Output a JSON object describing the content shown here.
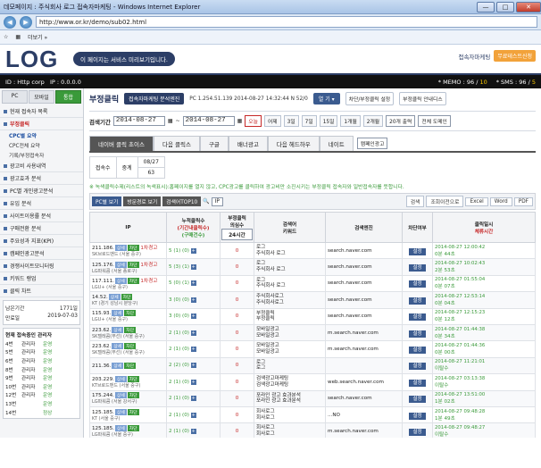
{
  "window": {
    "title": "데모페이지 : 주식회사 로그 접속자마케팅 - Windows Internet Explorer",
    "min": "—",
    "max": "□",
    "close": "✕"
  },
  "browser": {
    "url": "http://www.or.kr/demo/sub02.html",
    "tools": "더보기 »"
  },
  "header": {
    "logo": "LOG",
    "notice": "이 페이지는 서비스 미리보기입니다.",
    "brand": "접속자마케팅",
    "trial": "무료테스트신청"
  },
  "status": {
    "id": "ID : Http corp",
    "ip": "IP : 0.0.0.0",
    "memo_label": "* MEMO :",
    "memo": "96",
    "memo_total": "10",
    "sms_label": "* SMS :",
    "sms": "96",
    "sms_total": "5"
  },
  "sidebar": {
    "tabs": [
      "PC",
      "모바일",
      "통합"
    ],
    "menu": [
      {
        "label": "현재 접속자 목록",
        "on": false
      },
      {
        "label": "부정클릭",
        "on": true
      }
    ],
    "sub": [
      "CPC별 요약",
      "CPC전체 요약",
      "기록/부정접속자"
    ],
    "menu2": [
      "광고비 사용내역",
      "광고효과 분석",
      "PC별 개인광고분석",
      "유입 분석",
      "사이트이용률 분석",
      "구매전환 분석",
      "주요성과 지표(KPI)",
      "캠페인광고분석",
      "경쟁사이트모니터링",
      "키워드 랭업",
      "클릭 차트"
    ],
    "box": [
      {
        "k": "남은기간",
        "v": "1771일"
      },
      {
        "k": "만료일",
        "v": "2019-07-03"
      }
    ],
    "online_title": "현재 접속중인 관리자",
    "online": [
      {
        "n": "4번",
        "r": "관리자",
        "s": "운영"
      },
      {
        "n": "5번",
        "r": "관리자",
        "s": "운영"
      },
      {
        "n": "6번",
        "r": "관리자",
        "s": "운영"
      },
      {
        "n": "8번",
        "r": "관리자",
        "s": "운영"
      },
      {
        "n": "9번",
        "r": "관리자",
        "s": "운영"
      },
      {
        "n": "10번",
        "r": "관리자",
        "s": "운영"
      },
      {
        "n": "12번",
        "r": "관리자",
        "s": "운영"
      },
      {
        "n": "13번",
        "r": "",
        "s": "운영"
      },
      {
        "n": "14번",
        "r": "",
        "s": "정상"
      }
    ]
  },
  "page": {
    "title": "부정클릭",
    "engine": "접속자마케팅 분석엔진",
    "pcinfo": "PC 1.254.51.139 2014-08-27 14:32:44 N 52/0",
    "dropdown": "열 기 ▾",
    "btn_setting": "차단/부정클릭 설정",
    "btn_guide": "부정클릭 안내디스",
    "search_label": "검색기간",
    "date_from": "2014-08-27",
    "date_to": "2014-08-27",
    "quick": [
      "오늘",
      "어제",
      "3일",
      "7일",
      "15일",
      "1개월",
      "2개월"
    ],
    "per_page": "20개 출력",
    "domain": "전체 도메인",
    "tabs": [
      "네이버 클릭 초이스",
      "다음 클릭스",
      "구글",
      "배너광고",
      "다음 헤드하우",
      "네이트"
    ],
    "tab_select": "캠페인광고",
    "summary": {
      "h1": "접속수",
      "h2": "중계",
      "date": "08/27",
      "c1": "63",
      "c2": "63"
    },
    "info": "※ 녹색클릭수제(리스트의 녹색표시):홈페이지를 열지 않고, CPC광고를 클릭하여 광고비만 소진시키는 부정클릭 접속자와 일반접속자를 뜻합니다.",
    "actions": [
      "PC별 보기",
      "방문경로 보기",
      "검색어TOP10"
    ],
    "search_sel": "IP",
    "act_right": [
      "검색",
      "조회이전으로",
      "Excel",
      "Word",
      "PDF"
    ],
    "cols": {
      "ip": "IP",
      "clicks": "누적클릭수",
      "clicks2": "(기간내클릭수)",
      "clicks3": "(구매건수)",
      "fraud": "부정클릭",
      "fraud2": "의심수",
      "hours": "24시간",
      "search": "검색어",
      "keyword": "키워드",
      "engine": "검색엔진",
      "block": "차단여부",
      "time": "클릭일시",
      "stay": "체류시간"
    },
    "rows": [
      {
        "ip": "211.186.",
        "isp": "SK브로드밴드 (서울 중구)",
        "tag": "1차경고",
        "c": "5 (1) (0)",
        "z": "0",
        "s": "로그",
        "k": "주식회사 로그",
        "e": "search.naver.com",
        "t": "2014-08-27 12:00:42",
        "a": "0분 44초",
        "ar": false
      },
      {
        "ip": "125.176.",
        "isp": "LG파워콤 (서울 종로구)",
        "tag": "1차경고",
        "c": "5 (3) (1)",
        "z": "0",
        "s": "로그",
        "k": "주식회사 로그",
        "e": "search.naver.com",
        "t": "2014-08-27 10:02:43",
        "a": "2분 53초",
        "ar": false
      },
      {
        "ip": "117.111.",
        "isp": "LGU+ (서울 중구)",
        "tag": "1차경고",
        "c": "5 (0) (1)",
        "z": "0",
        "s": "로그",
        "k": "주식회사 로그",
        "e": "search.naver.com",
        "t": "2014-08-27 01:55:04",
        "a": "0분 07초",
        "ar": false
      },
      {
        "ip": "14.52.",
        "isp": "KT (경기 성남시 분당구)",
        "tag": "",
        "c": "3 (0) (0)",
        "z": "0",
        "s": "주식회사로그",
        "k": "주식회사로그",
        "e": "search.naver.com",
        "t": "2014-08-27 12:53:14",
        "a": "0분 04초",
        "ar": false
      },
      {
        "ip": "115.93.",
        "isp": "LGU+ (서울 중구)",
        "tag": "",
        "c": "3 (0) (0)",
        "z": "0",
        "s": "부정클릭",
        "k": "부정클릭",
        "e": "search.naver.com",
        "t": "2014-08-27 12:15:23",
        "a": "0분 12초",
        "ar": false
      },
      {
        "ip": "223.62.",
        "isp": "SK텔레콤(무선) (서울 중구)",
        "tag": "",
        "c": "2 (1) (0)",
        "z": "0",
        "s": "모바일광고",
        "k": "모바일광고",
        "e": "m.search.naver.com",
        "t": "2014-08-27 01:44:38",
        "a": "0분 34초",
        "ar": false
      },
      {
        "ip": "223.62.",
        "isp": "SK텔레콤(무선) (서울 중구)",
        "tag": "",
        "c": "2 (1) (0)",
        "z": "0",
        "s": "모바일광고",
        "k": "모바일광고",
        "e": "m.search.naver.com",
        "t": "2014-08-27 01:44:36",
        "a": "0분 00초",
        "ar": false
      },
      {
        "ip": "211.36.",
        "isp": "",
        "tag": "",
        "c": "2 (2) (0)",
        "z": "0",
        "s": "로그",
        "k": "로그",
        "e": "",
        "t": "2014-08-27 11:21:01",
        "a": "이탈수",
        "ar": false
      },
      {
        "ip": "203.229.",
        "isp": "KT브로드밴드 (서울 중구)",
        "tag": "",
        "c": "2 (1) (0)",
        "z": "0",
        "s": "검색광고마케팅",
        "k": "검색광고마케팅",
        "e": "web.search.naver.com",
        "t": "2014-08-27 03:13:38",
        "a": "이탈수",
        "ar": false
      },
      {
        "ip": "175.244.",
        "isp": "LG파워콤 (서울 강서구)",
        "tag": "",
        "c": "2 (1) (0)",
        "z": "0",
        "s": "포라인 광고 효과분석",
        "k": "포라인 광고 효과분석",
        "e": "search.naver.com",
        "t": "2014-08-27 13:51:00",
        "a": "1분 02초",
        "ar": false
      },
      {
        "ip": "125.185.",
        "isp": "KT (서울 중구)",
        "tag": "",
        "c": "2 (1) (0)",
        "z": "0",
        "s": "회사로그",
        "k": "회사로그",
        "e": "...NO",
        "t": "2014-08-27 09:48:28",
        "a": "1분 49초",
        "ar": false
      },
      {
        "ip": "125.185.",
        "isp": "LG파워콤 (서울 중구)",
        "tag": "",
        "c": "2 (1) (0)",
        "z": "0",
        "s": "회사로그",
        "k": "회사로그",
        "e": "m.search.naver.com",
        "t": "2014-08-27 09:48:27",
        "a": "이탈수",
        "ar": false
      }
    ],
    "block_label": "설정"
  }
}
